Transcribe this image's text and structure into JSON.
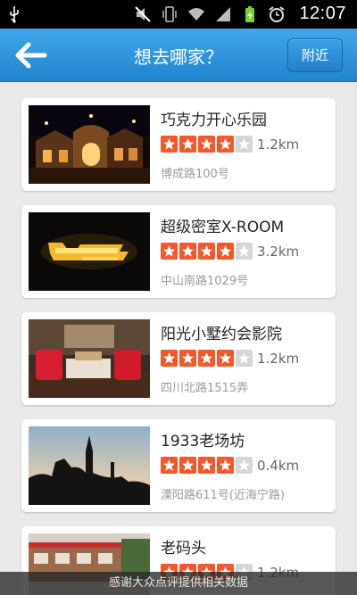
{
  "status_bar": {
    "time": "12:07",
    "icons": [
      "usb-icon",
      "mute-icon",
      "vibrate-icon",
      "wifi-icon",
      "signal-icon",
      "battery-icon",
      "alarm-icon"
    ]
  },
  "header": {
    "title": "想去哪家？",
    "nearby_label": "附近"
  },
  "places": [
    {
      "name": "巧克力开心乐园",
      "rating": 4,
      "distance": "1.2km",
      "address": "博成路100号"
    },
    {
      "name": "超级密室X-ROOM",
      "rating": 4,
      "distance": "3.2km",
      "address": "中山南路1029号"
    },
    {
      "name": "阳光小墅约会影院",
      "rating": 4,
      "distance": "1.2km",
      "address": "四川北路1515弄"
    },
    {
      "name": "1933老场坊",
      "rating": 4,
      "distance": "0.4km",
      "address": "溧阳路611号(近海宁路)"
    },
    {
      "name": "老码头",
      "rating": 4,
      "distance": "1.2km",
      "address": ""
    }
  ],
  "footer": {
    "credit": "感谢大众点评提供相关数据"
  },
  "colors": {
    "nav": "#2a90d8",
    "star_on": "#f1582a",
    "star_off": "#d6d6d6"
  }
}
